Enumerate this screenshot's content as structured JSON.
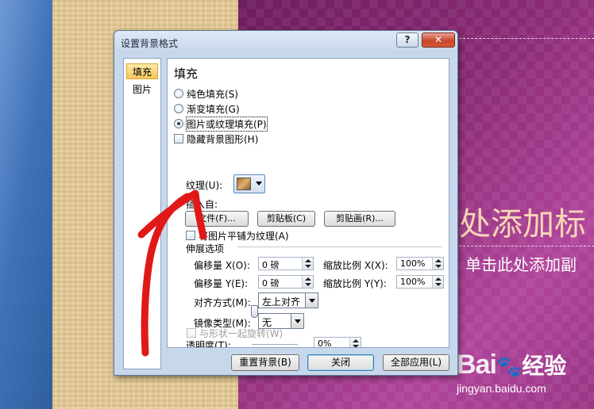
{
  "slide": {
    "title_partial": "处添加标",
    "subtitle_partial": "单击此处添加副",
    "watermark_brand": "Bai",
    "watermark_paw": "🐾",
    "watermark_jingyan": "经验",
    "watermark_url": "jingyan.baidu.com"
  },
  "dialog": {
    "title": "设置背景格式",
    "help_label": "?",
    "close_label": "✕",
    "nav": [
      {
        "label": "填充",
        "selected": true
      },
      {
        "label": "图片",
        "selected": false
      }
    ],
    "fill": {
      "heading": "填充",
      "options": [
        {
          "label": "纯色填充(S)",
          "checked": false
        },
        {
          "label": "渐变填充(G)",
          "checked": false
        },
        {
          "label": "图片或纹理填充(P)",
          "checked": true
        }
      ],
      "hide_bg_label": "隐藏背景图形(H)",
      "texture_label": "纹理(U):",
      "insert_from_label": "插入自:",
      "file_button": "文件(F)...",
      "clipboard_button": "剪贴板(C)",
      "clipart_button": "剪贴画(R)...",
      "tile_label": "将图片平铺为纹理(A)",
      "tile_checked": true,
      "stretch_options_label": "伸展选项",
      "offset_x_label": "偏移量 X(O):",
      "offset_x_value": "0 磅",
      "scale_x_label": "缩放比例 X(X):",
      "scale_x_value": "100%",
      "offset_y_label": "偏移量 Y(E):",
      "offset_y_value": "0 磅",
      "scale_y_label": "缩放比例 Y(Y):",
      "scale_y_value": "100%",
      "align_label": "对齐方式(M):",
      "align_value": "左上对齐",
      "mirror_label": "镜像类型(M):",
      "mirror_value": "无",
      "transparency_label": "透明度(T):",
      "transparency_value": "0%",
      "rotate_label": "与形状一起旋转(W)"
    },
    "footer": {
      "reset_button": "重置背景(B)",
      "close_button": "关闭",
      "apply_all_button": "全部应用(L)"
    }
  },
  "colors": {
    "slide_purple": "#8a2a76",
    "dialog_frame": "#c8d8ec",
    "nav_selected": "#f6c95b",
    "annotation_arrow": "#e01818"
  }
}
